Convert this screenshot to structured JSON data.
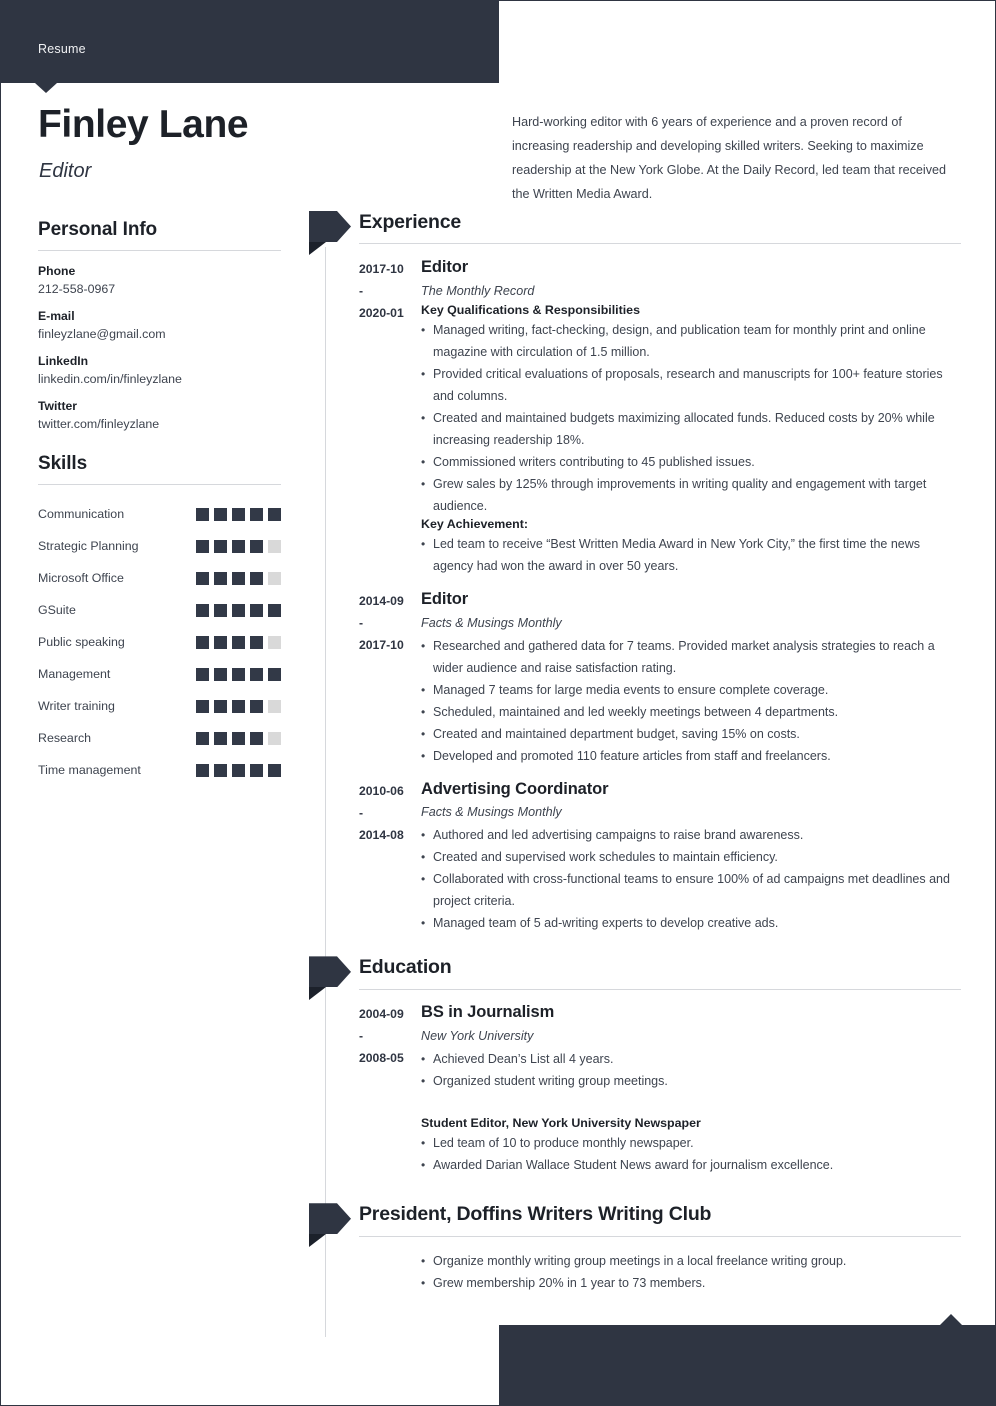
{
  "header": {
    "label": "Resume"
  },
  "identity": {
    "name": "Finley Lane",
    "title": "Editor",
    "summary": "Hard-working editor with 6 years of experience and a proven record of increasing readership and developing skilled writers. Seeking to maximize readership at the New York Globe. At the Daily Record, led team that received the Written Media Award."
  },
  "personal_info": {
    "heading": "Personal Info",
    "items": [
      {
        "label": "Phone",
        "value": "212-558-0967"
      },
      {
        "label": "E-mail",
        "value": "finleyzlane@gmail.com"
      },
      {
        "label": "LinkedIn",
        "value": "linkedin.com/in/finleyzlane"
      },
      {
        "label": "Twitter",
        "value": "twitter.com/finleyzlane"
      }
    ]
  },
  "skills": {
    "heading": "Skills",
    "max_level": 5,
    "items": [
      {
        "name": "Communication",
        "level": 5
      },
      {
        "name": "Strategic Planning",
        "level": 4
      },
      {
        "name": "Microsoft Office",
        "level": 4
      },
      {
        "name": "GSuite",
        "level": 5
      },
      {
        "name": "Public speaking",
        "level": 4
      },
      {
        "name": "Management",
        "level": 5
      },
      {
        "name": "Writer training",
        "level": 4
      },
      {
        "name": "Research",
        "level": 4
      },
      {
        "name": "Time management",
        "level": 5
      }
    ]
  },
  "experience": {
    "heading": "Experience",
    "entries": [
      {
        "date_start": "2017-10 -",
        "date_end": "2020-01",
        "role": "Editor",
        "org": "The Monthly Record",
        "sub_head": "Key Qualifications & Responsibilities",
        "bullets": [
          "Managed writing, fact-checking, design, and publication team for monthly print and online magazine with circulation of 1.5 million.",
          "Provided critical evaluations of proposals, research and manuscripts for 100+ feature stories and columns.",
          "Created and maintained budgets maximizing allocated funds. Reduced costs by 20% while increasing readership 18%.",
          "Commissioned writers contributing to 45 published issues.",
          "Grew sales by 125% through improvements in writing quality and engagement with target audience."
        ],
        "sub_head_2": "Key Achievement:",
        "bullets_2": [
          "Led team to receive “Best Written Media Award in New York City,” the first time the news agency had won the award in over 50 years."
        ]
      },
      {
        "date_start": "2014-09 -",
        "date_end": "2017-10",
        "role": "Editor",
        "org": "Facts & Musings Monthly",
        "bullets": [
          "Researched and gathered data for 7 teams. Provided market analysis strategies to reach a wider audience and raise satisfaction rating.",
          "Managed 7 teams for large media events to ensure complete coverage.",
          "Scheduled, maintained and led weekly meetings between 4 departments.",
          "Created and maintained department budget, saving 15% on costs.",
          "Developed and promoted 110 feature articles from staff and freelancers."
        ]
      },
      {
        "date_start": "2010-06 -",
        "date_end": "2014-08",
        "role": "Advertising Coordinator",
        "org": "Facts & Musings Monthly",
        "bullets": [
          "Authored and led advertising campaigns to raise brand awareness.",
          "Created and supervised work schedules to maintain efficiency.",
          "Collaborated with cross-functional teams to ensure 100% of ad campaigns met deadlines and project criteria.",
          "Managed team of 5 ad-writing experts to develop creative ads."
        ]
      }
    ]
  },
  "education": {
    "heading": "Education",
    "entries": [
      {
        "date_start": "2004-09 -",
        "date_end": "2008-05",
        "role": "BS in Journalism",
        "org": "New York University",
        "bullets": [
          "Achieved Dean’s List all 4 years.",
          "Organized student writing group meetings."
        ],
        "sub_head_2": "Student Editor, New York University Newspaper",
        "bullets_2": [
          "Led team of 10 to produce monthly newspaper.",
          "Awarded Darian Wallace Student News award for journalism excellence."
        ]
      }
    ]
  },
  "club": {
    "heading": "President, Doffins Writers Writing Club",
    "bullets": [
      "Organize monthly writing group meetings in a local freelance writing group.",
      "Grew membership 20% in 1 year to 73 members."
    ]
  },
  "colors": {
    "dark": "#2f3542",
    "text": "#3e444f",
    "heading": "#1d2128",
    "rule": "#d6d8dc",
    "skill_on": "#323947",
    "skill_off": "#d9d9d9"
  }
}
